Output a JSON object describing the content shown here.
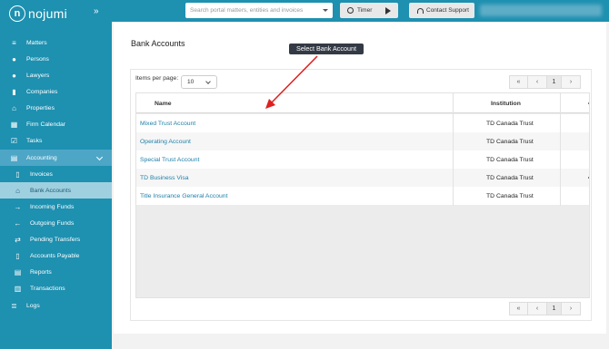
{
  "app": {
    "logo_text": "nojumi",
    "logo_mark": "n"
  },
  "topbar": {
    "search_placeholder": "Search portal matters, entities and invoices",
    "timer_label": "Timer",
    "support_label": "Contact Support"
  },
  "sidebar": {
    "items": [
      {
        "label": "Matters",
        "icon": "layers-icon"
      },
      {
        "label": "Persons",
        "icon": "people-icon"
      },
      {
        "label": "Lawyers",
        "icon": "person-icon"
      },
      {
        "label": "Companies",
        "icon": "building-icon"
      },
      {
        "label": "Properties",
        "icon": "home-icon"
      },
      {
        "label": "Firm Calendar",
        "icon": "calendar-icon"
      },
      {
        "label": "Tasks",
        "icon": "checkbox-icon"
      },
      {
        "label": "Accounting",
        "icon": "ledger-icon",
        "expanded": true
      },
      {
        "label": "Invoices",
        "icon": "document-icon"
      },
      {
        "label": "Bank Accounts",
        "icon": "bank-icon",
        "active": true
      },
      {
        "label": "Incoming Funds",
        "icon": "arrow-right-icon"
      },
      {
        "label": "Outgoing Funds",
        "icon": "arrow-left-icon"
      },
      {
        "label": "Pending Transfers",
        "icon": "transfer-icon"
      },
      {
        "label": "Accounts Payable",
        "icon": "document-icon"
      },
      {
        "label": "Reports",
        "icon": "report-icon"
      },
      {
        "label": "Transactions",
        "icon": "transactions-icon"
      },
      {
        "label": "Logs",
        "icon": "logs-icon"
      }
    ]
  },
  "page": {
    "title": "Bank Accounts",
    "tooltip": "Select Bank Account",
    "items_per_page_label": "Items per page:",
    "items_per_page_value": "10",
    "pager": {
      "first": "«",
      "prev": "‹",
      "current": "1",
      "next": "›"
    }
  },
  "table": {
    "columns": [
      "Name",
      "Institution"
    ],
    "rows": [
      {
        "name": "Mixed Trust Account",
        "institution": "TD Canada Trust"
      },
      {
        "name": "Operating Account",
        "institution": "TD Canada Trust"
      },
      {
        "name": "Special Trust Account",
        "institution": "TD Canada Trust"
      },
      {
        "name": "TD Business Visa",
        "institution": "TD Canada Trust"
      },
      {
        "name": "Title Insurance General Account",
        "institution": "TD Canada Trust"
      }
    ]
  },
  "colors": {
    "brand": "#1e90b0",
    "active_parent": "#4da6c6",
    "active_sub": "#9fd0e0",
    "link": "#1e7fa8",
    "annotation_arrow": "#e02020"
  }
}
